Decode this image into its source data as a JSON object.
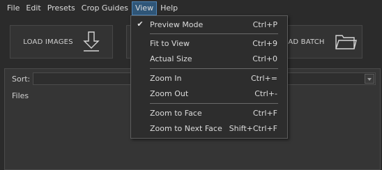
{
  "menubar": {
    "items": [
      {
        "label": "File",
        "active": false
      },
      {
        "label": "Edit",
        "active": false
      },
      {
        "label": "Presets",
        "active": false
      },
      {
        "label": "Crop Guides",
        "active": false
      },
      {
        "label": "View",
        "active": true
      },
      {
        "label": "Help",
        "active": false
      }
    ]
  },
  "toolbar": {
    "load_images_label": "LOAD IMAGES",
    "load_batch_label": "AD BATCH"
  },
  "panel": {
    "sort_label": "Sort:",
    "sort_value": "",
    "files_label": "Files"
  },
  "view_menu": {
    "items": [
      {
        "label": "Preview Mode",
        "shortcut": "Ctrl+P",
        "checked": true
      },
      {
        "label": "Fit to View",
        "shortcut": "Ctrl+9",
        "checked": false
      },
      {
        "label": "Actual Size",
        "shortcut": "Ctrl+0",
        "checked": false
      },
      {
        "label": "Zoom In",
        "shortcut": "Ctrl+=",
        "checked": false
      },
      {
        "label": "Zoom Out",
        "shortcut": "Ctrl+-",
        "checked": false
      },
      {
        "label": "Zoom to Face",
        "shortcut": "Ctrl+F",
        "checked": false
      },
      {
        "label": "Zoom to Next Face",
        "shortcut": "Shift+Ctrl+F",
        "checked": false
      }
    ],
    "check_glyph": "✔"
  },
  "colors": {
    "background": "#2b2b2b",
    "panel": "#353535",
    "menu_active": "#2f5678",
    "menu_active_border": "#4f86b8",
    "dropdown": "#2d2d2d"
  },
  "icons": {
    "load_images": "download-arrow-icon",
    "load_batch": "folder-icon",
    "check": "check-icon",
    "select_arrow": "chevron-down-icon"
  }
}
